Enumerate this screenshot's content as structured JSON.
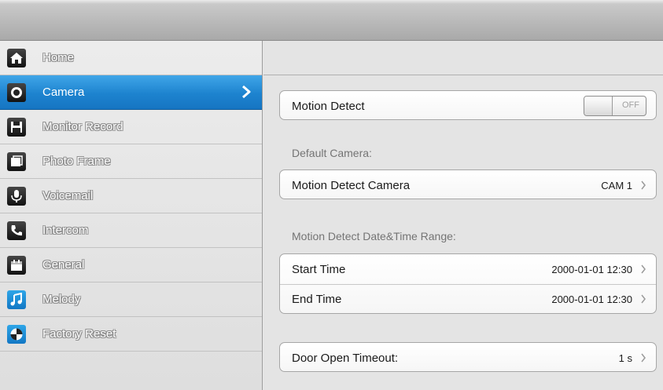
{
  "sidebar": {
    "items": [
      {
        "label": "Home",
        "icon": "home-icon"
      },
      {
        "label": "Camera",
        "icon": "camera-icon",
        "active": true
      },
      {
        "label": "Monitor Record",
        "icon": "save-icon"
      },
      {
        "label": "Photo Frame",
        "icon": "photo-frame-icon"
      },
      {
        "label": "Voicemail",
        "icon": "microphone-icon"
      },
      {
        "label": "Intercom",
        "icon": "phone-icon"
      },
      {
        "label": "General",
        "icon": "calendar-icon"
      },
      {
        "label": "Melody",
        "icon": "music-note-icon"
      },
      {
        "label": "Factory Reset",
        "icon": "reset-icon"
      }
    ]
  },
  "main": {
    "motion_detect": {
      "label": "Motion Detect",
      "toggle_state": "OFF"
    },
    "default_camera_label": "Default Camera:",
    "motion_detect_camera": {
      "label": "Motion Detect Camera",
      "value": "CAM 1"
    },
    "range_label": "Motion Detect Date&Time Range:",
    "start_time": {
      "label": "Start Time",
      "value": "2000-01-01 12:30"
    },
    "end_time": {
      "label": "End Time",
      "value": "2000-01-01 12:30"
    },
    "door_open_timeout": {
      "label": "Door Open Timeout:",
      "value": "1 s"
    }
  },
  "colors": {
    "accent": "#1d83cf",
    "sidebar_bg": "#e6e6e6",
    "card_border": "#a6a6a6"
  }
}
